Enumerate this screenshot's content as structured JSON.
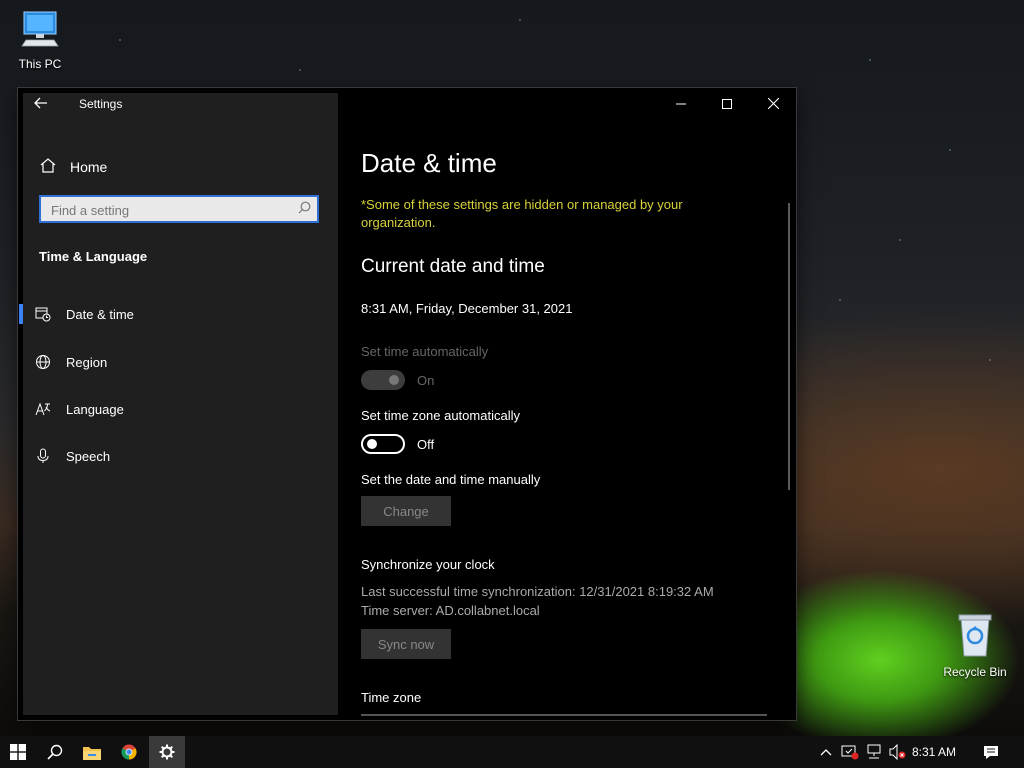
{
  "desktop": {
    "icons": [
      {
        "label": "This PC"
      },
      {
        "label": "Recycle Bin"
      }
    ]
  },
  "window": {
    "title": "Settings",
    "back_icon": "arrow-left-icon",
    "controls": {
      "minimize": "minimize-icon",
      "maximize": "maximize-icon",
      "close": "close-icon"
    }
  },
  "sidebar": {
    "home_label": "Home",
    "search_placeholder": "Find a setting",
    "section_title": "Time & Language",
    "items": [
      {
        "label": "Date & time",
        "icon": "calendar-clock-icon",
        "active": true
      },
      {
        "label": "Region",
        "icon": "globe-icon",
        "active": false
      },
      {
        "label": "Language",
        "icon": "language-icon",
        "active": false
      },
      {
        "label": "Speech",
        "icon": "microphone-icon",
        "active": false
      }
    ]
  },
  "content": {
    "title": "Date & time",
    "warning": "*Some of these settings are hidden or managed by your organization.",
    "current_heading": "Current date and time",
    "current_datetime": "8:31 AM, Friday, December 31, 2021",
    "set_time_auto_label": "Set time automatically",
    "set_time_auto_state": "On",
    "set_tz_auto_label": "Set time zone automatically",
    "set_tz_auto_state": "Off",
    "manual_label": "Set the date and time manually",
    "change_button": "Change",
    "sync_heading": "Synchronize your clock",
    "sync_last": "Last successful time synchronization: 12/31/2021 8:19:32 AM",
    "sync_server": "Time server: AD.collabnet.local",
    "sync_button": "Sync now",
    "timezone_label": "Time zone"
  },
  "taskbar": {
    "clock": "8:31 AM",
    "accent": "#3b82f6"
  }
}
